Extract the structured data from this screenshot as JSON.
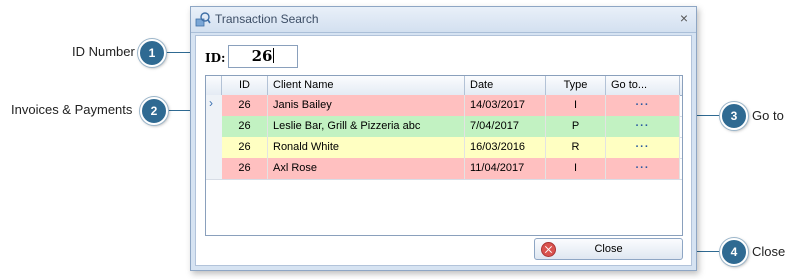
{
  "callouts": [
    {
      "number": "1",
      "label": "ID Number"
    },
    {
      "number": "2",
      "label": "Invoices & Payments"
    },
    {
      "number": "3",
      "label": "Go to"
    },
    {
      "number": "4",
      "label": "Close"
    }
  ],
  "window": {
    "title": "Transaction Search",
    "close_glyph": "×"
  },
  "id_field": {
    "label": "ID:",
    "value": "26"
  },
  "grid": {
    "columns": [
      "ID",
      "Client Name",
      "Date",
      "Type",
      "Go to..."
    ],
    "rows": [
      {
        "id": "26",
        "client": "Janis Bailey",
        "date": "14/03/2017",
        "type": "I",
        "goto": "···",
        "color": "#ffc0c0",
        "selected": true
      },
      {
        "id": "26",
        "client": "Leslie Bar, Grill & Pizzeria abc",
        "date": "7/04/2017",
        "type": "P",
        "goto": "···",
        "color": "#c2f2c2",
        "selected": false
      },
      {
        "id": "26",
        "client": "Ronald White",
        "date": "16/03/2016",
        "type": "R",
        "goto": "···",
        "color": "#ffffc2",
        "selected": false
      },
      {
        "id": "26",
        "client": "Axl Rose",
        "date": "11/04/2017",
        "type": "I",
        "goto": "···",
        "color": "#ffc0c0",
        "selected": false
      }
    ]
  },
  "buttons": {
    "close_label": "Close"
  },
  "icons": {
    "app": "app-search-icon",
    "row_indicator": "chevron-right-icon",
    "close_button": "stop-icon"
  }
}
